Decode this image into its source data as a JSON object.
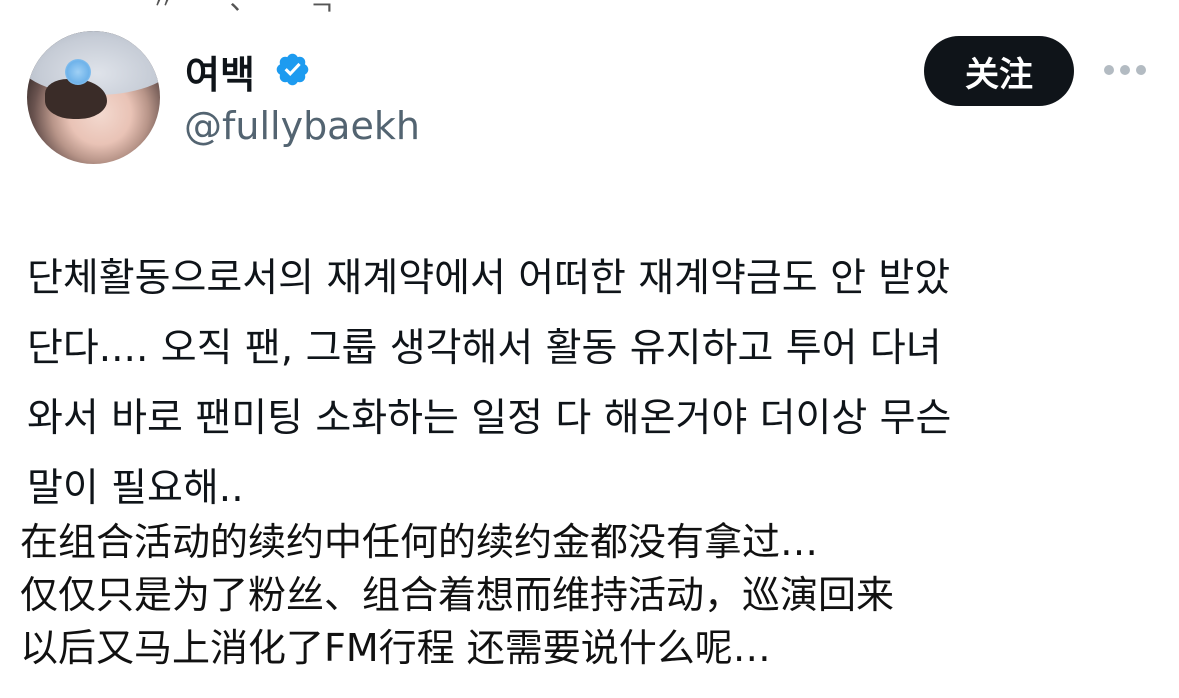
{
  "top_clipped_text": "〃 ᆢ 、 ᄂ ᆨ ᄉ",
  "profile": {
    "display_name": "여백",
    "handle": "@fullybaekh",
    "verified": true,
    "verified_color": "#1d9bf0"
  },
  "actions": {
    "follow_label": "关注",
    "more_icon": "ellipsis-icon"
  },
  "tweet": {
    "korean_lines": [
      "단체활동으로서의 재계약에서 어떠한 재계약금도 안 받았",
      "단다.... 오직 팬, 그룹 생각해서 활동 유지하고 투어 다녀",
      "와서 바로 팬미팅 소화하는 일정 다 해온거야 더이상 무슨",
      "말이 필요해.."
    ],
    "chinese_lines": [
      "在组合活动的续约中任何的续约金都没有拿过…",
      "仅仅只是为了粉丝、组合着想而维持活动，巡演回来",
      "以后又马上消化了FM行程 还需要说什么呢…"
    ]
  },
  "bottom_clipped_text": "ー ー ー ー   ーー 一 ー ーー",
  "colors": {
    "text_primary": "#0f1419",
    "text_secondary": "#536471",
    "follow_bg": "#0f1419",
    "follow_text": "#ffffff"
  }
}
